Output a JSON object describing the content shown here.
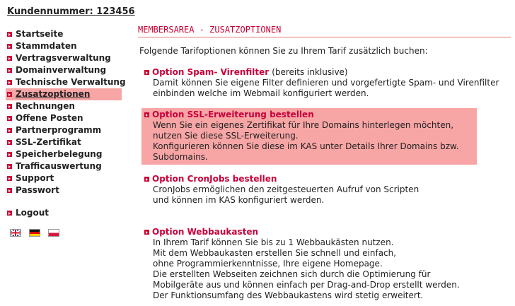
{
  "customer": {
    "label": "Kundennummer: 123456"
  },
  "nav": {
    "items": [
      {
        "label": "Startseite"
      },
      {
        "label": "Stammdaten"
      },
      {
        "label": "Vertragsverwaltung"
      },
      {
        "label": "Domainverwaltung"
      },
      {
        "label": "Technische Verwaltung"
      },
      {
        "label": "Zusatzoptionen",
        "active": true
      },
      {
        "label": "Rechnungen"
      },
      {
        "label": "Offene Posten"
      },
      {
        "label": "Partnerprogramm"
      },
      {
        "label": "SSL-Zertifikat"
      },
      {
        "label": "Speicherbelegung"
      },
      {
        "label": "Trafficauswertung"
      },
      {
        "label": "Support"
      },
      {
        "label": "Passwort"
      }
    ],
    "logout": "Logout"
  },
  "languages": [
    "english-flag-icon",
    "german-flag-icon",
    "polish-flag-icon"
  ],
  "main": {
    "title": "MEMBERSAREA - ZUSATZOPTIONEN",
    "intro": "Folgende Tarifoptionen können Sie zu Ihrem Tarif zusätzlich buchen:",
    "options": [
      {
        "title": "Option Spam- Virenfilter",
        "note": "(bereits inklusive)",
        "lines": [
          "Damit können Sie eigene Filter definieren und vorgefertigte Spam- und Virenfilter",
          "einbinden welche im Webmail konfiguriert werden."
        ]
      },
      {
        "title": "Option SSL-Erweiterung bestellen",
        "lines": [
          "Wenn Sie ein eigenes Zertifikat für Ihre Domains hinterlegen möchten,",
          "nutzen Sie diese SSL-Erweiterung.",
          "Konfigurieren können Sie diese im KAS unter Details Ihrer Domains bzw.",
          "Subdomains."
        ]
      },
      {
        "title": "Option CronJobs bestellen",
        "lines": [
          "CronJobs ermöglichen den zeitgesteuerten Aufruf von Scripten",
          "und können im KAS konfiguriert werden."
        ]
      },
      {
        "title": "Option Webbaukasten",
        "lines": [
          "In Ihrem Tarif können Sie bis zu 1 Webbaukästen nutzen.",
          "Mit dem Webbaukasten erstellen Sie schnell und einfach,",
          "ohne Programmierkenntnisse, Ihre eigene Homepage.",
          "Die erstellten Webseiten zeichnen sich durch die Optimierung für",
          "Mobilgeräte aus und können einfach per Drag-and-Drop erstellt werden.",
          "Der Funktionsumfang des Webbaukastens wird stetig erweitert."
        ]
      }
    ]
  },
  "colors": {
    "accent": "#cc0033",
    "highlight": "#f7a5a5",
    "text": "#222222"
  }
}
